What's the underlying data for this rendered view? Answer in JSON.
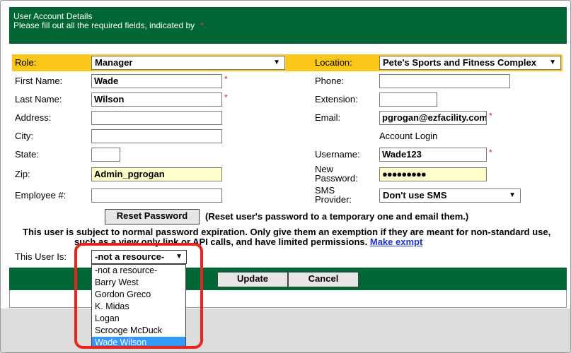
{
  "header": {
    "title": "User Account Details",
    "instructions": "Please fill out all the required fields, indicated by",
    "required_mark": "*."
  },
  "form": {
    "role": {
      "label": "Role:",
      "value": "Manager"
    },
    "location": {
      "label": "Location:",
      "value": "Pete's Sports and Fitness Complex"
    },
    "first_name": {
      "label": "First Name:",
      "value": "Wade"
    },
    "last_name": {
      "label": "Last Name:",
      "value": "Wilson"
    },
    "address": {
      "label": "Address:",
      "value": ""
    },
    "city": {
      "label": "City:",
      "value": ""
    },
    "state": {
      "label": "State:",
      "value": ""
    },
    "zip": {
      "label": "Zip:",
      "value": "Admin_pgrogan"
    },
    "employee_num": {
      "label": "Employee #:",
      "value": ""
    },
    "phone": {
      "label": "Phone:",
      "value": ""
    },
    "extension": {
      "label": "Extension:",
      "value": ""
    },
    "email": {
      "label": "Email:",
      "value": "pgrogan@ezfacility.com"
    },
    "account_login_heading": "Account Login",
    "username": {
      "label": "Username:",
      "value": "Wade123"
    },
    "new_password": {
      "label_line1": "New",
      "label_line2": "Password:",
      "value": "●●●●●●●●●"
    },
    "sms_provider": {
      "label_line1": "SMS",
      "label_line2": "Provider:",
      "value": "Don't use SMS"
    },
    "required_star": "*"
  },
  "reset": {
    "button_label": "Reset Password",
    "note": "(Reset user's password to a temporary one and email them.)"
  },
  "expiration": {
    "line1": "This user is subject to normal password expiration. Only give them an exemption if they are meant for non-standard use,",
    "line2": "such as a view only link or API calls, and have limited permissions.",
    "link": "Make exmpt"
  },
  "user_is": {
    "label": "This User Is:",
    "selected": "-not a resource-",
    "options": [
      "-not a resource-",
      "Barry West",
      "Gordon Greco",
      "K. Midas",
      "Logan",
      "Scrooge McDuck",
      "Wade Wilson"
    ],
    "highlighted_option": "Wade Wilson"
  },
  "actions": {
    "update_label": "Update",
    "cancel_label": "Cancel"
  },
  "colors": {
    "header_bg": "#006633",
    "role_row_bg": "#fdc71a",
    "required": "#e02020",
    "callout": "#e8241c",
    "selection": "#3399ff"
  }
}
